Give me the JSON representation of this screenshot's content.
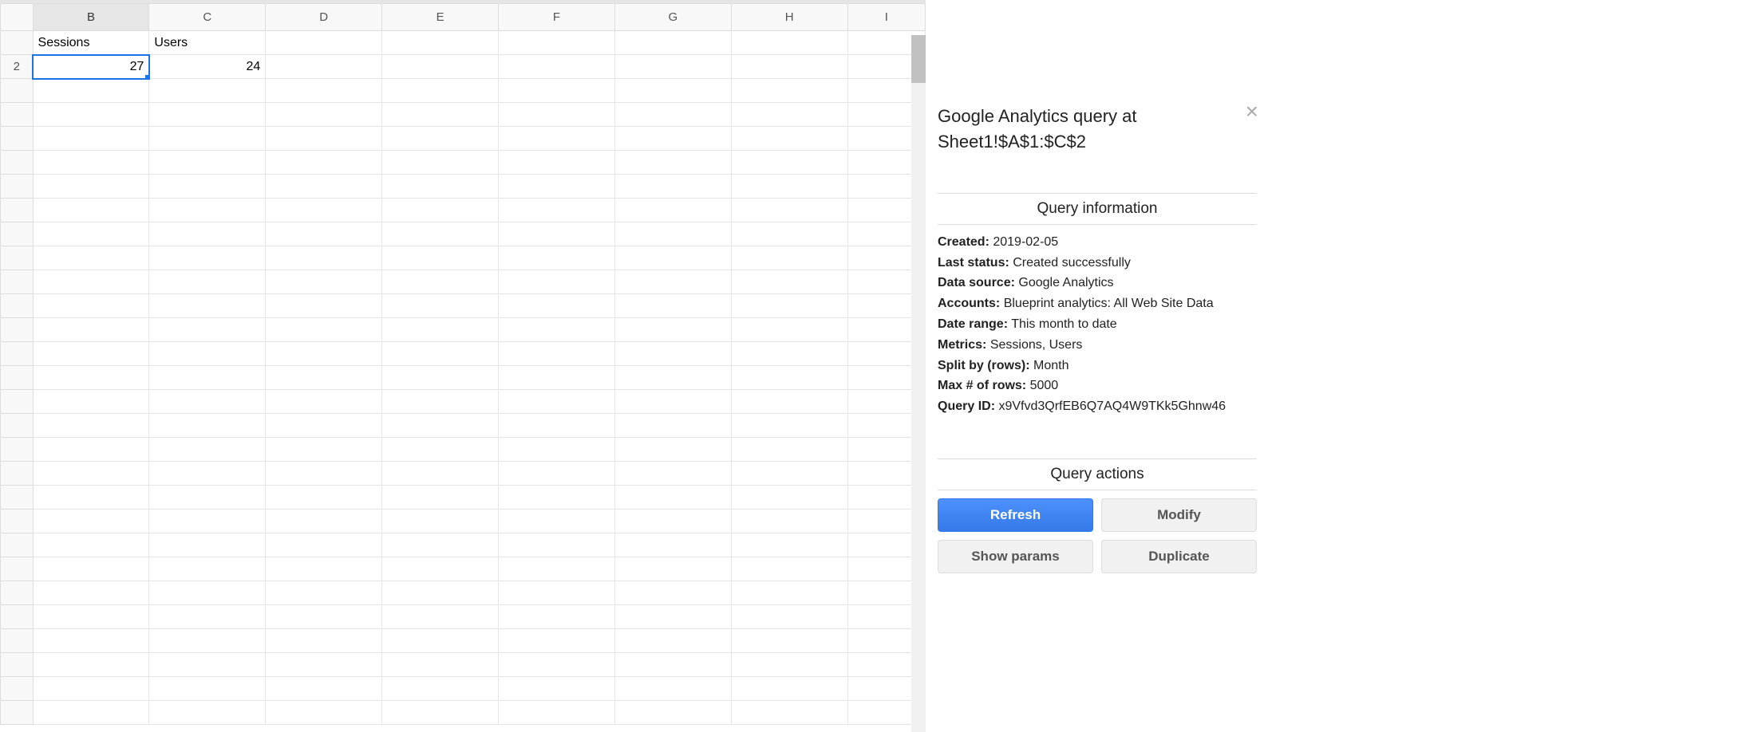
{
  "sheet": {
    "row_header_visible": "2",
    "columns": [
      "B",
      "C",
      "D",
      "E",
      "F",
      "G",
      "H",
      "I"
    ],
    "selected_column": "B",
    "headers_row": {
      "B": "Sessions",
      "C": "Users"
    },
    "data_row": {
      "B": "27",
      "C": "24"
    },
    "selected_cell": "B2"
  },
  "panel": {
    "title": "Google Analytics query at Sheet1!$A$1:$C$2",
    "section_info": "Query information",
    "info": {
      "created_label": "Created:",
      "created": "2019-02-05",
      "last_status_label": "Last status:",
      "last_status": "Created successfully",
      "data_source_label": "Data source:",
      "data_source": "Google Analytics",
      "accounts_label": "Accounts:",
      "accounts": "Blueprint analytics: All Web Site Data",
      "date_range_label": "Date range:",
      "date_range": "This month to date",
      "metrics_label": "Metrics:",
      "metrics": "Sessions, Users",
      "split_by_label": "Split by (rows):",
      "split_by": "Month",
      "max_rows_label": "Max # of rows:",
      "max_rows": "5000",
      "query_id_label": "Query ID:",
      "query_id": "x9Vfvd3QrfEB6Q7AQ4W9TKk5Ghnw46"
    },
    "section_actions": "Query actions",
    "buttons": {
      "refresh": "Refresh",
      "modify": "Modify",
      "show_params": "Show params",
      "duplicate": "Duplicate"
    }
  }
}
